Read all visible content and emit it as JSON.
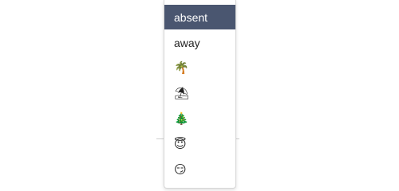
{
  "dropdown": {
    "selected_bg": "#4a5670",
    "options": [
      {
        "label": "absent",
        "selected": true
      },
      {
        "label": "away",
        "selected": false
      },
      {
        "label": "🌴",
        "icon": "palm-tree-icon",
        "selected": false
      },
      {
        "label": "⛱",
        "icon": "beach-umbrella-icon",
        "selected": false
      },
      {
        "label": "🎄",
        "icon": "christmas-tree-icon",
        "selected": false
      },
      {
        "label": "😇",
        "icon": "halo-face-icon",
        "selected": false
      },
      {
        "label": "😏",
        "icon": "smirk-face-icon",
        "selected": false
      }
    ]
  }
}
